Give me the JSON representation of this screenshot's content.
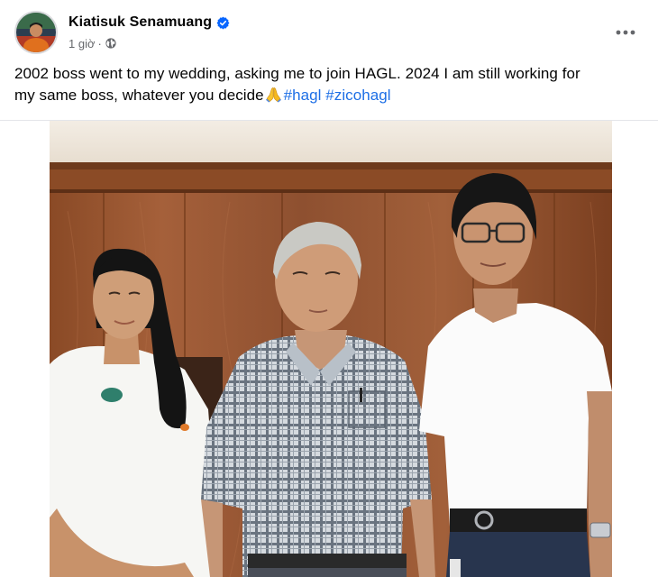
{
  "post": {
    "author": {
      "name": "Kiatisuk Senamuang",
      "verified": true,
      "avatar_icon": "profile-avatar"
    },
    "meta": {
      "time": "1 giờ",
      "separator": "·",
      "audience_icon": "globe-icon"
    },
    "more_icon": "more-horizontal-icon",
    "text": {
      "line1": "2002 boss went to my wedding, asking me to join HAGL. 2024 I am still working for",
      "line2": "my same boss, whatever you decide",
      "emoji": "folded-hands",
      "hashtags": [
        "#hagl",
        "#zicohagl"
      ]
    },
    "photo": {
      "subject": "group-photo"
    }
  },
  "colors": {
    "text_primary": "#050505",
    "text_secondary": "#65676b",
    "hashtag": "#1d6fe6",
    "verified_badge": "#0866ff"
  }
}
